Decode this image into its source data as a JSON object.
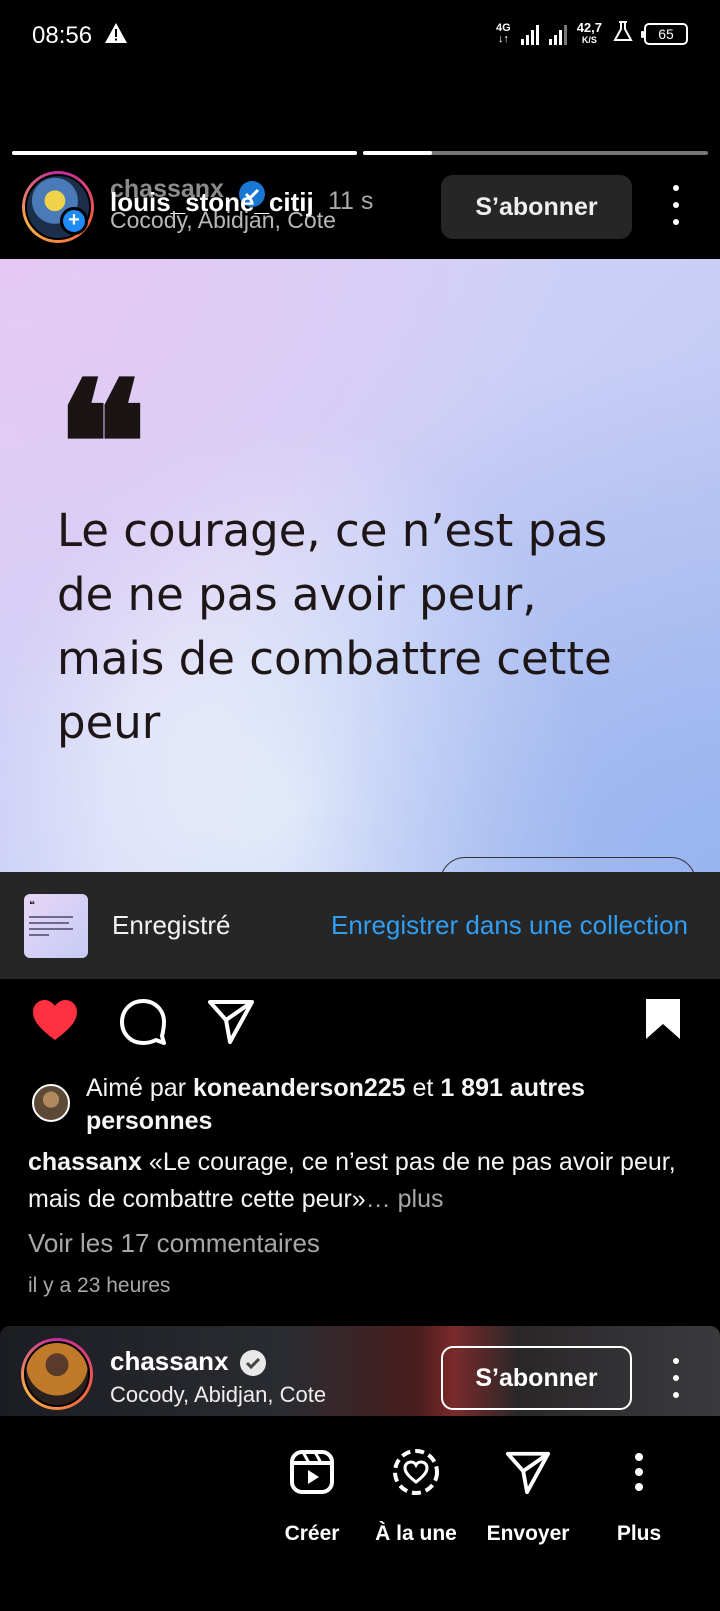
{
  "status_bar": {
    "time": "08:56",
    "network": "4G",
    "speed_value": "42,7",
    "speed_unit": "K/S",
    "battery": "65"
  },
  "story": {
    "progress": [
      1.0,
      0.2
    ],
    "ghost_username": "chassanx",
    "username": "louis_stone_citij",
    "time": "11 s",
    "location": "Cocody, Abidjan, Cote",
    "follow_label": "S’abonner"
  },
  "post_image": {
    "quote_mark": "❝",
    "quote_text": "Le courage, ce n’est pas de ne pas avoir peur, mais de combattre cette peur"
  },
  "saved_bar": {
    "label": "Enregistré",
    "collection_link": "Enregistrer dans une collection"
  },
  "likes": {
    "prefix": "Aimé par ",
    "user": "koneanderson225",
    "middle": " et ",
    "count": "1 891 autres personnes"
  },
  "caption": {
    "user": "chassanx",
    "text": " «Le courage, ce n’est pas de ne pas avoir peur, mais de combattre cette peur»",
    "ellipsis": "…",
    "more": " plus"
  },
  "comments_link": "Voir les 17 commentaires",
  "time_ago": "il y a 23 heures",
  "next_post": {
    "username": "chassanx",
    "location": "Cocody, Abidjan, Cote",
    "follow_label": "S’abonner"
  },
  "bottom_bar": {
    "items": [
      {
        "label": "Créer",
        "icon": "reels-create-icon"
      },
      {
        "label": "À la une",
        "icon": "highlight-heart-icon"
      },
      {
        "label": "Envoyer",
        "icon": "send-icon"
      },
      {
        "label": "Plus",
        "icon": "more-vertical-icon"
      }
    ]
  },
  "colors": {
    "like_red": "#ff3040",
    "link_blue": "#2f9ef4",
    "verified_blue": "#1d8cf8",
    "background": "#000000"
  }
}
